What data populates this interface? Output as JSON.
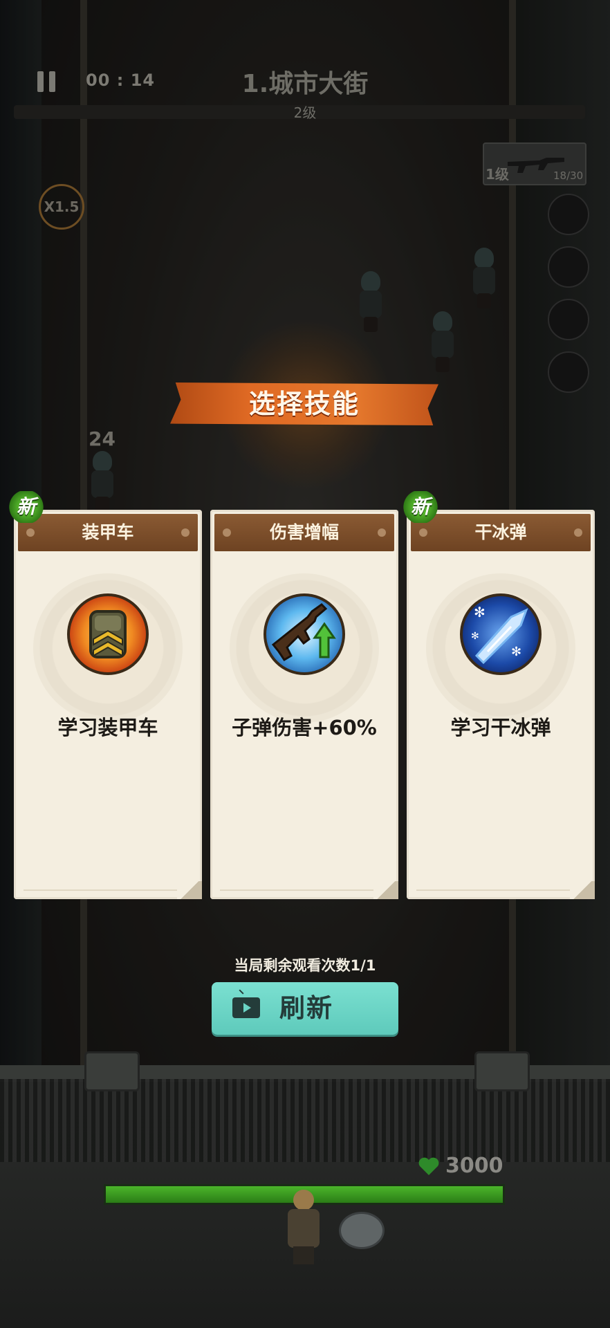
{
  "hud": {
    "timer": "00 : 14",
    "stage_title": "1.城市大街",
    "stage_level": "2级",
    "speed": "X1.5",
    "weapon_level": "1级",
    "weapon_ammo": "18/30",
    "damage_number": "24"
  },
  "dialog": {
    "title": "选择技能",
    "cards": [
      {
        "name": "装甲车",
        "description": "学习装甲车",
        "is_new": true,
        "new_label": "新",
        "icon": "armored-vehicle-icon"
      },
      {
        "name": "伤害增幅",
        "description": "子弹伤害+60%",
        "is_new": false,
        "icon": "rifle-damage-up-icon"
      },
      {
        "name": "干冰弹",
        "description": "学习干冰弹",
        "is_new": true,
        "new_label": "新",
        "icon": "ice-bullet-icon"
      }
    ],
    "watch_remaining": "当局剩余观看次数1/1",
    "refresh_label": "刷新"
  },
  "base": {
    "hp": "3000",
    "hp_fraction": 1.0
  },
  "colors": {
    "banner": "#e06a24",
    "card_header": "#7a4c29",
    "card_bg": "#f4eee0",
    "refresh_button": "#6ad4c5",
    "new_badge": "#4aa725",
    "hp_bar": "#3e9f22"
  }
}
